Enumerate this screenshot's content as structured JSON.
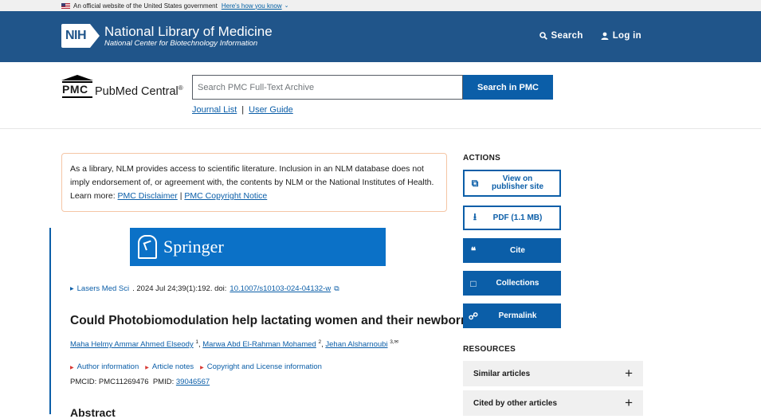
{
  "gov_banner": {
    "text": "An official website of the United States government",
    "link": "Here's how you know"
  },
  "nlm": {
    "badge": "NIH",
    "title": "National Library of Medicine",
    "subtitle": "National Center for Biotechnology Information",
    "search_label": "Search",
    "login_label": "Log in"
  },
  "pmc": {
    "logo_letters": "PMC",
    "logo_name": "PubMed Central",
    "logo_reg": "®",
    "search_placeholder": "Search PMC Full-Text Archive",
    "search_button": "Search in PMC",
    "journal_list": "Journal List",
    "separator": "|",
    "user_guide": "User Guide"
  },
  "disclaimer": {
    "text": "As a library, NLM provides access to scientific literature. Inclusion in an NLM database does not imply endorsement of, or agreement with, the contents by NLM or the National Institutes of Health. Learn more:",
    "link1": "PMC Disclaimer",
    "sep": "|",
    "link2": "PMC Copyright Notice"
  },
  "article": {
    "publisher_logo": "Springer",
    "journal": "Lasers Med Sci",
    "citation": ". 2024 Jul 24;39(1):192. doi: ",
    "doi": "10.1007/s10103-024-04132-w",
    "title": "Could Photobiomodulation help lactating women and their newborns?",
    "authors": [
      {
        "name": "Maha Helmy Ammar Ahmed Elseody",
        "sup": "1"
      },
      {
        "name": "Marwa Abd El-Rahman Mohamed",
        "sup": "2"
      },
      {
        "name": "Jehan Alsharnoubi",
        "sup": "3,✉"
      }
    ],
    "info_links": [
      "Author information",
      "Article notes",
      "Copyright and License information"
    ],
    "pmcid_label": "PMCID: PMC11269476",
    "pmid_label": "PMID:",
    "pmid": "39046567",
    "abstract_heading": "Abstract"
  },
  "sidebar": {
    "actions_heading": "ACTIONS",
    "actions": [
      {
        "label": "View on publisher site",
        "icon": "external-link-icon"
      },
      {
        "label": "PDF (1.1 MB)",
        "icon": "download-icon"
      },
      {
        "label": "Cite",
        "icon": "quote-icon"
      },
      {
        "label": "Collections",
        "icon": "bookmark-icon"
      },
      {
        "label": "Permalink",
        "icon": "share-icon"
      }
    ],
    "resources_heading": "RESOURCES",
    "resources": [
      {
        "label": "Similar articles"
      },
      {
        "label": "Cited by other articles"
      }
    ]
  },
  "colors": {
    "nlm_blue": "#20558a",
    "pmc_blue": "#0b5ea8",
    "springer_blue": "#0b71c7"
  }
}
